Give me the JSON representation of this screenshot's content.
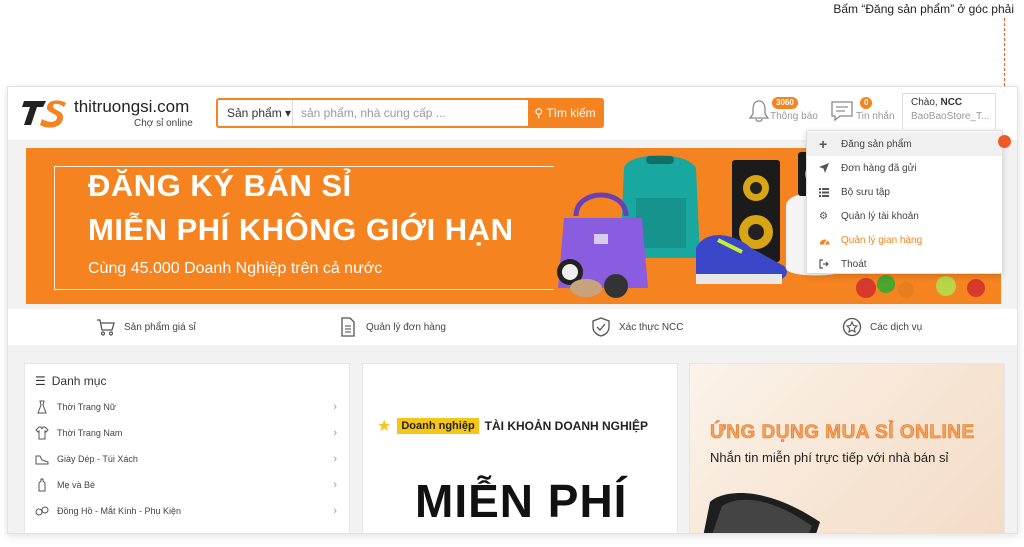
{
  "annotation": {
    "text": "Bấm “Đăng sản phẩm” ở góc phải"
  },
  "header": {
    "logo_text": "thitruongsi.com",
    "logo_sub": "Chợ sỉ online",
    "search": {
      "category": "Sản phẩm ▾",
      "placeholder": "sản phẩm, nhà cung cấp ...",
      "button": "Tìm kiếm"
    },
    "notifications": {
      "count": "3060",
      "label": "Thông báo"
    },
    "messages": {
      "count": "0",
      "label": "Tin nhắn"
    },
    "account": {
      "greeting": "Chào,",
      "name": "NCC",
      "store": "BaoBaoStore_T..."
    }
  },
  "banner": {
    "line1": "ĐĂNG KÝ BÁN SỈ",
    "line2": "MIỄN PHÍ KHÔNG GIỚI HẠN",
    "line3": "Cùng 45.000 Doanh Nghiệp trên cả nước"
  },
  "features": [
    {
      "label": "Sản phẩm giá sỉ",
      "icon": "cart-icon"
    },
    {
      "label": "Quản lý đơn hàng",
      "icon": "document-icon"
    },
    {
      "label": "Xác thực NCC",
      "icon": "shield-check-icon"
    },
    {
      "label": "Các dịch vụ",
      "icon": "star-badge-icon"
    }
  ],
  "categories": {
    "title": "Danh mục",
    "items": [
      {
        "label": "Thời Trang Nữ",
        "icon": "dress-icon"
      },
      {
        "label": "Thời Trang Nam",
        "icon": "shirt-icon"
      },
      {
        "label": "Giày Dép - Túi Xách",
        "icon": "shoe-icon"
      },
      {
        "label": "Mẹ và Bé",
        "icon": "bottle-icon"
      },
      {
        "label": "Đồng Hồ - Mắt Kính - Phụ Kiện",
        "icon": "glasses-icon"
      }
    ]
  },
  "promo_business": {
    "badge": "Doanh nghiệp",
    "title": "TÀI KHOẢN DOANH NGHIỆP",
    "big": "MIỄN PHÍ"
  },
  "promo_app": {
    "title": "ỨNG DỤNG MUA SỈ ONLINE",
    "subtitle": "Nhắn tin miễn phí trực tiếp với nhà bán sỉ"
  },
  "dropdown": {
    "items": [
      {
        "label": "Đăng sản phẩm",
        "icon": "plus-icon",
        "active": true
      },
      {
        "label": "Đơn hàng đã gửi",
        "icon": "send-icon"
      },
      {
        "label": "Bộ sưu tập",
        "icon": "list-icon"
      },
      {
        "label": "Quản lý tài khoản",
        "icon": "gear-icon"
      },
      {
        "label": "Quản lý gian hàng",
        "icon": "dashboard-icon",
        "accent": true
      },
      {
        "label": "Thoát",
        "icon": "logout-icon"
      }
    ]
  },
  "colors": {
    "brand_orange": "#f5831f",
    "annotation_red": "#f05a28",
    "badge_yellow": "#f5c518"
  }
}
